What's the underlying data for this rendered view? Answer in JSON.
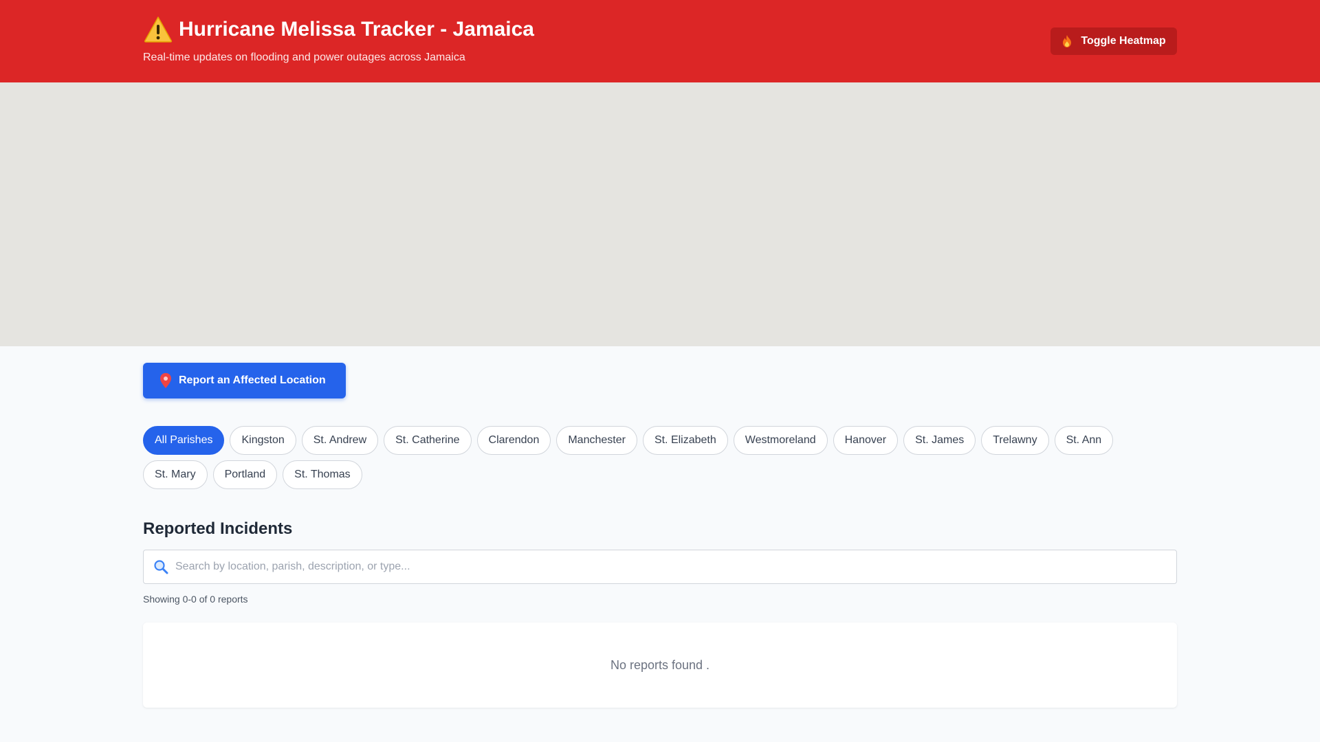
{
  "header": {
    "title": "Hurricane Melissa Tracker - Jamaica",
    "subtitle": "Real-time updates on flooding and power outages across Jamaica",
    "heatmap_button": "Toggle Heatmap",
    "icons": {
      "title": "warning-icon",
      "heatmap": "flame-icon"
    },
    "colors": {
      "header_bg": "#dc2626",
      "heatmap_btn_bg": "#b91c1c"
    }
  },
  "report": {
    "button_label": "Report an Affected Location",
    "icon": "map-pin-icon",
    "color": "#2563eb"
  },
  "parishes": [
    {
      "label": "All Parishes",
      "active": true
    },
    {
      "label": "Kingston",
      "active": false
    },
    {
      "label": "St. Andrew",
      "active": false
    },
    {
      "label": "St. Catherine",
      "active": false
    },
    {
      "label": "Clarendon",
      "active": false
    },
    {
      "label": "Manchester",
      "active": false
    },
    {
      "label": "St. Elizabeth",
      "active": false
    },
    {
      "label": "Westmoreland",
      "active": false
    },
    {
      "label": "Hanover",
      "active": false
    },
    {
      "label": "St. James",
      "active": false
    },
    {
      "label": "Trelawny",
      "active": false
    },
    {
      "label": "St. Ann",
      "active": false
    },
    {
      "label": "St. Mary",
      "active": false
    },
    {
      "label": "Portland",
      "active": false
    },
    {
      "label": "St. Thomas",
      "active": false
    }
  ],
  "incidents": {
    "title": "Reported Incidents",
    "search_placeholder": "Search by location, parish, description, or type...",
    "search_value": "",
    "count_text": "Showing 0-0 of 0 reports",
    "empty_text": "No reports found ."
  }
}
